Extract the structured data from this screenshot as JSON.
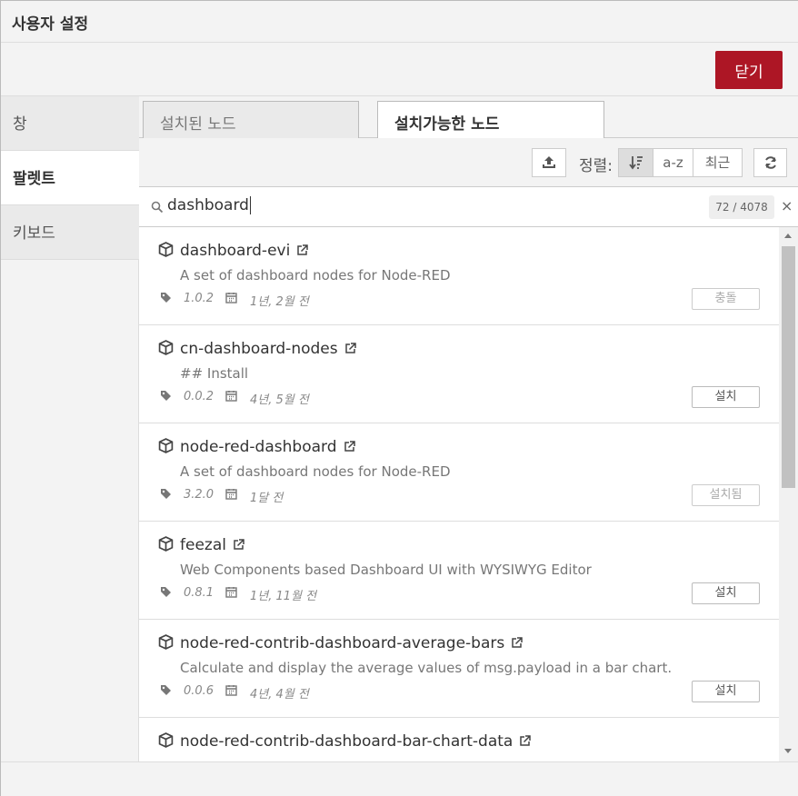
{
  "dialog": {
    "title": "사용자 설정",
    "close_label": "닫기"
  },
  "sidebar": {
    "items": [
      {
        "label": "창"
      },
      {
        "label": "팔렛트"
      },
      {
        "label": "키보드"
      }
    ],
    "active_index": 1
  },
  "tabs": [
    {
      "label": "설치된 노드"
    },
    {
      "label": "설치가능한 노드"
    }
  ],
  "active_tab": 1,
  "toolbar": {
    "sort_label": "정렬:",
    "sort_options": [
      "a-z",
      "최근"
    ]
  },
  "search": {
    "value": "dashboard",
    "count": "72 / 4078",
    "clear_symbol": "×"
  },
  "packages": [
    {
      "name": "dashboard-evi",
      "description": "A set of dashboard nodes for Node-RED",
      "version": "1.0.2",
      "updated": "1년, 2월 전",
      "action": "충돌",
      "disabled": true
    },
    {
      "name": "cn-dashboard-nodes",
      "description": "## Install",
      "version": "0.0.2",
      "updated": "4년, 5월 전",
      "action": "설치",
      "disabled": false
    },
    {
      "name": "node-red-dashboard",
      "description": "A set of dashboard nodes for Node-RED",
      "version": "3.2.0",
      "updated": "1달 전",
      "action": "설치됨",
      "disabled": true
    },
    {
      "name": "feezal",
      "description": "Web Components based Dashboard UI with WYSIWYG Editor",
      "version": "0.8.1",
      "updated": "1년, 11월 전",
      "action": "설치",
      "disabled": false
    },
    {
      "name": "node-red-contrib-dashboard-average-bars",
      "description": "Calculate and display the average values of msg.payload in a bar chart.",
      "version": "0.0.6",
      "updated": "4년, 4월 전",
      "action": "설치",
      "disabled": false
    },
    {
      "name": "node-red-contrib-dashboard-bar-chart-data",
      "description": "",
      "version": "",
      "updated": "",
      "action": "",
      "disabled": false
    }
  ],
  "colors": {
    "close_button": "#ad1625",
    "panel_bg": "#f3f3f3"
  }
}
